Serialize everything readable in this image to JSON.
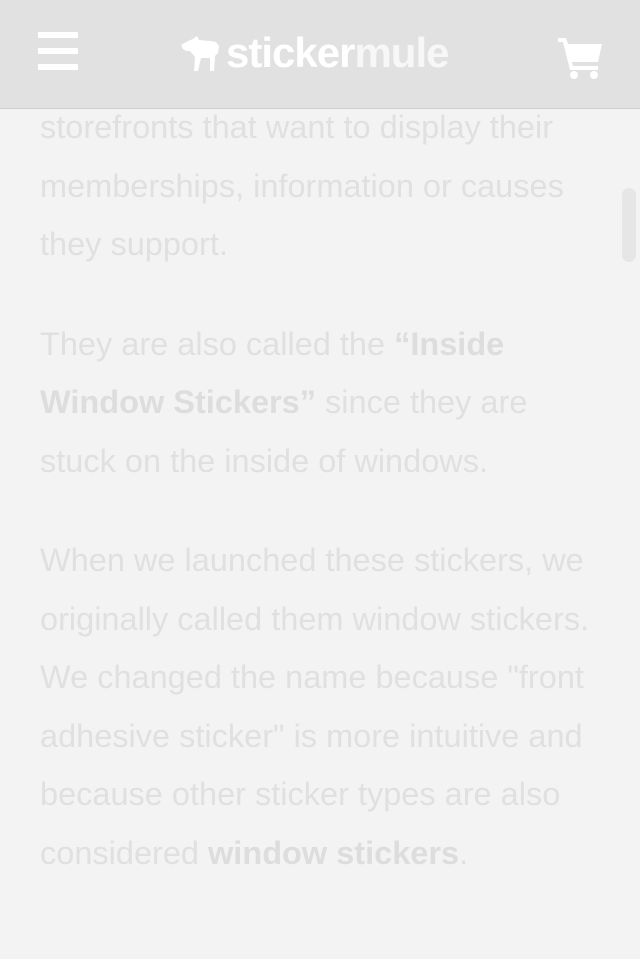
{
  "header": {
    "logo_part1": "sticker",
    "logo_part2": "mule",
    "menu_icon": "hamburger-menu-icon",
    "cart_icon": "shopping-cart-icon",
    "colors": {
      "bar": "#e1e1e1",
      "icons": "#ffffff"
    }
  },
  "article": {
    "p1": "storefronts that want to display their memberships, information or causes they support.",
    "p2_before": "They are also called the ",
    "p2_bold": "“Inside Window Stickers”",
    "p2_after": " since they are stuck on the inside of windows.",
    "p3_before": "When we launched these stickers, we originally called them window stickers. We changed the name because \"front adhesive sticker\" is more intuitive and because other sticker types are also considered ",
    "p3_bold": "window stickers",
    "p3_after": "."
  }
}
